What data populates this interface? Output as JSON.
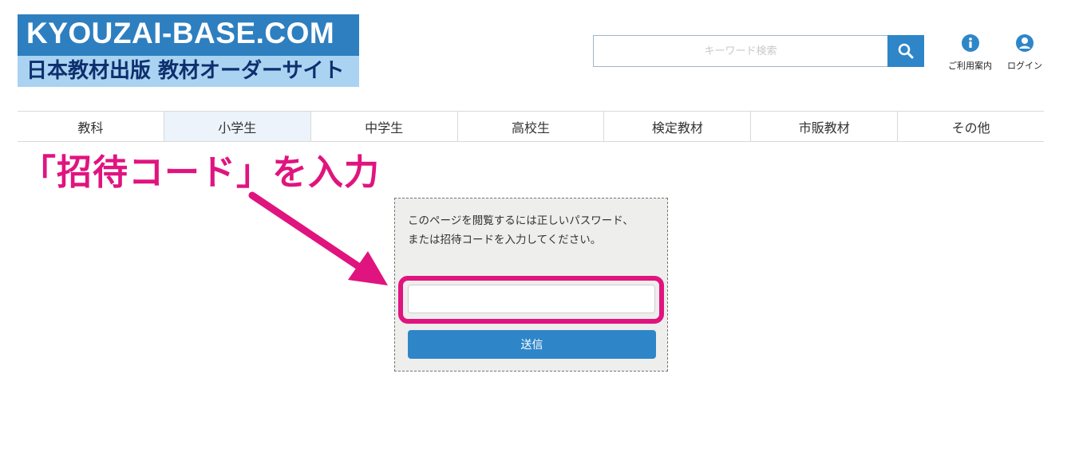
{
  "logo": {
    "line1": "KYOUZAI-BASE.COM",
    "line2": "日本教材出版 教材オーダーサイト"
  },
  "search": {
    "placeholder": "キーワード検索",
    "button_icon": "search-icon"
  },
  "header_links": {
    "guide": {
      "label": "ご利用案内",
      "icon": "info-icon"
    },
    "login": {
      "label": "ログイン",
      "icon": "user-icon"
    }
  },
  "nav": {
    "items": [
      "教科",
      "小学生",
      "中学生",
      "高校生",
      "検定教材",
      "市販教材",
      "その他"
    ],
    "active_index": 1
  },
  "annotation": {
    "text": "「招待コード」を入力",
    "color": "#e0147f"
  },
  "form": {
    "message": "このページを閲覧するには正しいパスワード、 または招待コードを入力してください。",
    "input_value": "",
    "submit_label": "送信"
  },
  "colors": {
    "brand_blue": "#2e86c8",
    "logo_light": "#a9d3f0",
    "logo_text_dark": "#0d2f6e",
    "accent_pink": "#e0147f"
  }
}
